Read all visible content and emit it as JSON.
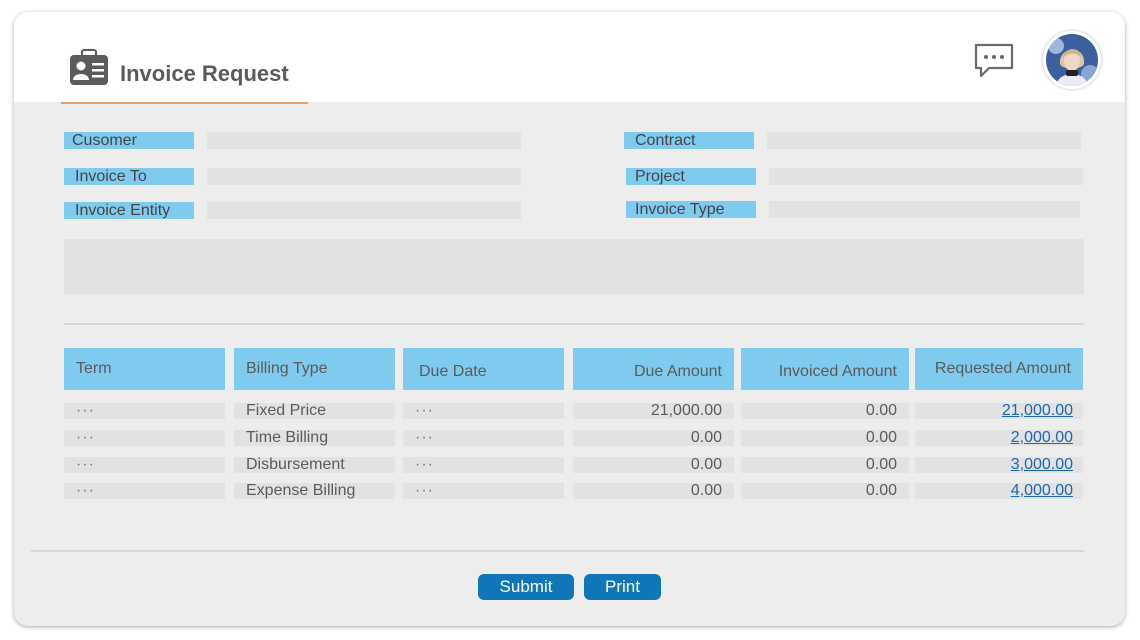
{
  "header": {
    "title": "Invoice Request",
    "title_icon": "id-card-icon",
    "chat_icon": "chat-bubble-icon",
    "avatar": "user-avatar"
  },
  "form": {
    "customer_label": "Cusomer",
    "customer_value": "",
    "invoice_to_label": "Invoice To",
    "invoice_to_value": "",
    "invoice_entity_label": "Invoice Entity",
    "invoice_entity_value": "",
    "contract_label": "Contract",
    "contract_value": "",
    "project_label": "Project",
    "project_value": "",
    "invoice_type_label": "Invoice Type",
    "invoice_type_value": "",
    "notes_value": ""
  },
  "table": {
    "headers": [
      "Term",
      "Billing Type",
      "Due Date",
      "Due Amount",
      "Invoiced Amount",
      "Requested Amount"
    ],
    "rows": [
      {
        "term": "···",
        "billing_type": "Fixed Price",
        "due_date": "···",
        "due_amount": "21,000.00",
        "invoiced_amount": "0.00",
        "requested_amount": "21,000.00"
      },
      {
        "term": "···",
        "billing_type": "Time Billing",
        "due_date": "···",
        "due_amount": "0.00",
        "invoiced_amount": "0.00",
        "requested_amount": "2,000.00"
      },
      {
        "term": "···",
        "billing_type": "Disbursement",
        "due_date": "···",
        "due_amount": "0.00",
        "invoiced_amount": "0.00",
        "requested_amount": "3,000.00"
      },
      {
        "term": "···",
        "billing_type": "Expense Billing",
        "due_date": "···",
        "due_amount": "0.00",
        "invoiced_amount": "0.00",
        "requested_amount": "4,000.00"
      }
    ]
  },
  "actions": {
    "submit_label": "Submit",
    "print_label": "Print"
  },
  "colors": {
    "label_bg": "#7fcbf0",
    "field_bg": "#e2e2e2",
    "accent_underline": "#e8a06a",
    "button_bg": "#0f77b8",
    "link": "#1a66b8"
  }
}
